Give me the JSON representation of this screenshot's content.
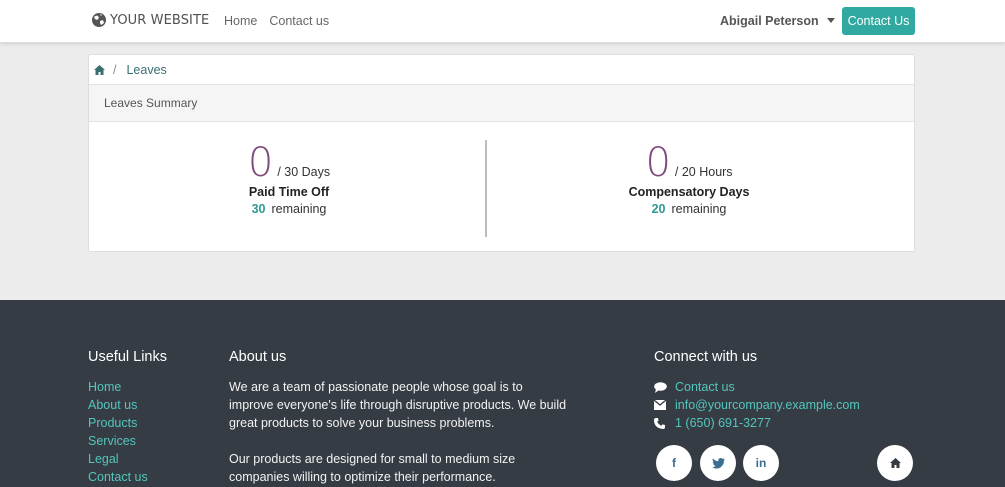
{
  "header": {
    "logo_text": "YOUR WEBSITE",
    "nav": [
      {
        "label": "Home"
      },
      {
        "label": "Contact us"
      }
    ],
    "user_name": "Abigail Peterson",
    "cta_label": "Contact Us"
  },
  "breadcrumb": {
    "separator": "/",
    "current": "Leaves"
  },
  "summary": {
    "title": "Leaves Summary",
    "items": [
      {
        "taken": "0",
        "total": "/ 30 Days",
        "name": "Paid Time Off",
        "remaining_value": "30",
        "remaining_label": "remaining"
      },
      {
        "taken": "0",
        "total": "/ 20 Hours",
        "name": "Compensatory Days",
        "remaining_value": "20",
        "remaining_label": "remaining"
      }
    ]
  },
  "footer": {
    "useful_links": {
      "title": "Useful Links",
      "items": [
        "Home",
        "About us",
        "Products",
        "Services",
        "Legal",
        "Contact us"
      ]
    },
    "about": {
      "title": "About us",
      "paragraph1": "We are a team of passionate people whose goal is to improve everyone's life through disruptive products. We build great products to solve your business problems.",
      "paragraph2": "Our products are designed for small to medium size companies willing to optimize their performance."
    },
    "connect": {
      "title": "Connect with us",
      "contact_label": "Contact us",
      "email": "info@yourcompany.example.com",
      "phone": "1 (650) 691-3277"
    },
    "social": {
      "facebook": "f",
      "linkedin": "in"
    }
  },
  "colors": {
    "accent": "#30a9a1",
    "number_purple": "#7e4a79",
    "footer_bg": "#363c44",
    "link_teal": "#53c5bd"
  }
}
